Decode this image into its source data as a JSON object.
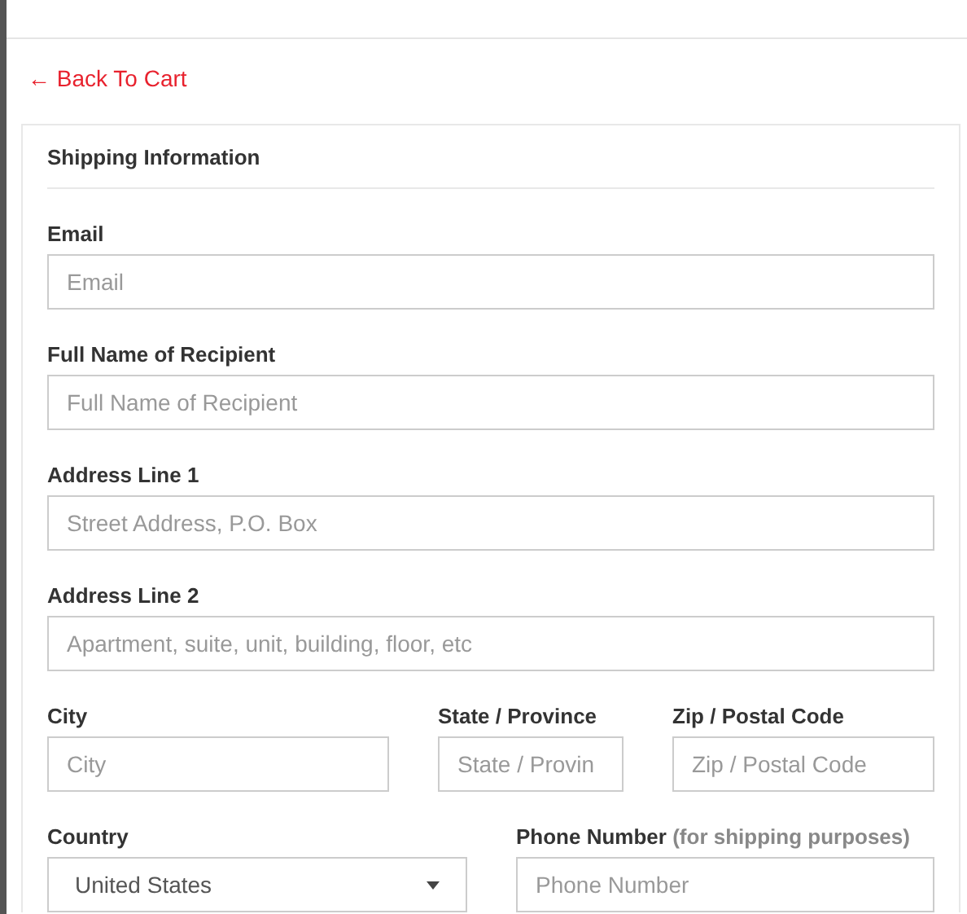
{
  "back_link": {
    "arrow": "←",
    "label": "Back To Cart"
  },
  "shipping": {
    "heading": "Shipping Information",
    "fields": [
      {
        "label": "Email",
        "placeholder": "Email",
        "kind": "input"
      },
      {
        "label": "Full Name of Recipient",
        "placeholder": "Full Name of Recipient",
        "kind": "input"
      },
      {
        "label": "Address Line 1",
        "placeholder": "Street Address, P.O. Box",
        "kind": "input"
      },
      {
        "label": "Address Line 2",
        "placeholder": "Apartment, suite, unit, building, floor, etc",
        "kind": "input"
      }
    ],
    "city_row": [
      {
        "label": "City",
        "placeholder": "City",
        "kind": "input"
      },
      {
        "label": "State / Province",
        "placeholder": "State / Provin",
        "kind": "input"
      },
      {
        "label": "Zip / Postal Code",
        "placeholder": "Zip / Postal Code",
        "kind": "input"
      }
    ],
    "contact_row": [
      {
        "label": "Country",
        "value": "United States",
        "kind": "select"
      },
      {
        "label": "Phone Number",
        "note": "(for shipping purposes)",
        "placeholder": "Phone Number",
        "kind": "input"
      }
    ]
  }
}
